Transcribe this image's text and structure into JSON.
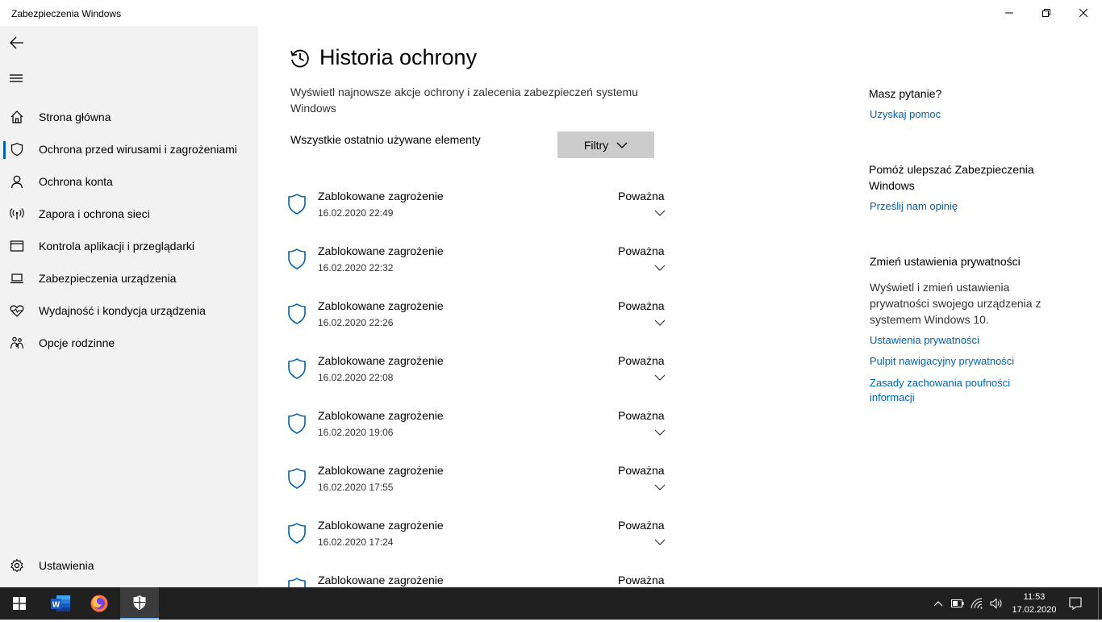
{
  "window": {
    "title": "Zabezpieczenia Windows"
  },
  "sidebar": {
    "items": [
      {
        "label": "Strona główna",
        "icon": "home-icon"
      },
      {
        "label": "Ochrona przed wirusami i zagrożeniami",
        "icon": "shield-icon",
        "active": true
      },
      {
        "label": "Ochrona konta",
        "icon": "person-icon"
      },
      {
        "label": "Zapora i ochrona sieci",
        "icon": "antenna-icon"
      },
      {
        "label": "Kontrola aplikacji i przeglądarki",
        "icon": "app-window-icon"
      },
      {
        "label": "Zabezpieczenia urządzenia",
        "icon": "laptop-icon"
      },
      {
        "label": "Wydajność i kondycja urządzenia",
        "icon": "heart-pulse-icon"
      },
      {
        "label": "Opcje rodzinne",
        "icon": "family-icon"
      }
    ],
    "settings_label": "Ustawienia"
  },
  "main": {
    "title": "Historia ochrony",
    "description": "Wyświetl najnowsze akcje ochrony i zalecenia zabezpieczeń systemu Windows",
    "filter_label": "Wszystkie ostatnio używane elementy",
    "filter_button": "Filtry",
    "history": [
      {
        "title": "Zablokowane zagrożenie",
        "date": "16.02.2020 22:49",
        "severity": "Poważna"
      },
      {
        "title": "Zablokowane zagrożenie",
        "date": "16.02.2020 22:32",
        "severity": "Poważna"
      },
      {
        "title": "Zablokowane zagrożenie",
        "date": "16.02.2020 22:26",
        "severity": "Poważna"
      },
      {
        "title": "Zablokowane zagrożenie",
        "date": "16.02.2020 22:08",
        "severity": "Poważna"
      },
      {
        "title": "Zablokowane zagrożenie",
        "date": "16.02.2020 19:06",
        "severity": "Poważna"
      },
      {
        "title": "Zablokowane zagrożenie",
        "date": "16.02.2020 17:55",
        "severity": "Poważna"
      },
      {
        "title": "Zablokowane zagrożenie",
        "date": "16.02.2020 17:24",
        "severity": "Poważna"
      },
      {
        "title": "Zablokowane zagrożenie",
        "date": "",
        "severity": "Poważna"
      }
    ]
  },
  "right": {
    "question_heading": "Masz pytanie?",
    "help_link": "Uzyskaj pomoc",
    "improve_heading": "Pomóż ulepszać Zabezpieczenia Windows",
    "feedback_link": "Prześlij nam opinię",
    "privacy_heading": "Zmień ustawienia prywatności",
    "privacy_text": "Wyświetl i zmień ustawienia prywatności swojego urządzenia z systemem Windows 10.",
    "privacy_settings_link": "Ustawienia prywatności",
    "privacy_dashboard_link": "Pulpit nawigacyjny prywatności",
    "privacy_statement_link": "Zasady zachowania poufności informacji"
  },
  "taskbar": {
    "time": "11:53",
    "date": "17.02.2020"
  },
  "colors": {
    "accent": "#0063b1",
    "sidebar_bg": "#f2f2f2",
    "taskbar_bg": "#202020"
  }
}
